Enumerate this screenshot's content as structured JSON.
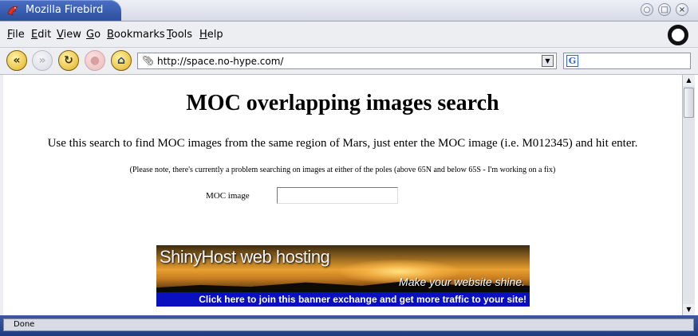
{
  "window": {
    "title": "Mozilla Firebird",
    "controls": {
      "minimize": "○",
      "maximize": "□",
      "close": "×"
    }
  },
  "menu": [
    {
      "key": "F",
      "rest": "ile"
    },
    {
      "key": "E",
      "rest": "dit"
    },
    {
      "key": "V",
      "rest": "iew"
    },
    {
      "key": "G",
      "rest": "o"
    },
    {
      "key": "B",
      "rest": "ookmarks"
    },
    {
      "key": "T",
      "rest": "ools"
    },
    {
      "key": "H",
      "rest": "elp"
    }
  ],
  "toolbar": {
    "back_icon": "«",
    "forward_icon": "»",
    "reload_icon": "↻",
    "stop_icon": "●",
    "home_icon": "⌂",
    "url": "http://space.no-hype.com/",
    "search_value": ""
  },
  "page": {
    "heading": "MOC overlapping images search",
    "intro": "Use this search to find MOC images from the same region of Mars, just enter the MOC image (i.e. M012345) and hit enter.",
    "note": "(Please note, there's currently a problem searching on images at either of the poles (above 65N and below 65S - I'm working on a fix)",
    "form": {
      "label": "MOC image",
      "value": ""
    },
    "banner": {
      "brand": "ShinyHost web hosting",
      "tagline": "Make your website shine.",
      "link": "Click here to join this banner exchange and get more traffic to your site!"
    }
  },
  "status": {
    "text": "Done"
  }
}
